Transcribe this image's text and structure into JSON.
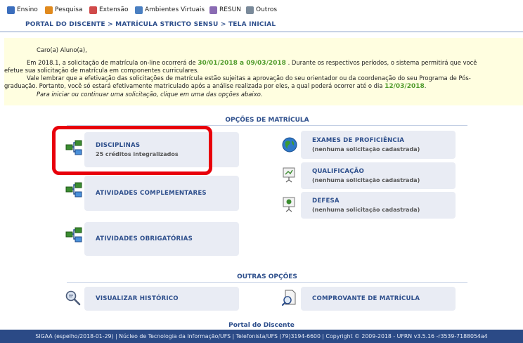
{
  "menu": {
    "items": [
      {
        "label": "Ensino",
        "icon": "ensino-icon",
        "color": "#3b6ebd"
      },
      {
        "label": "Pesquisa",
        "icon": "pesquisa-icon",
        "color": "#e08a1e"
      },
      {
        "label": "Extensão",
        "icon": "extensao-icon",
        "color": "#d04a4a"
      },
      {
        "label": "Ambientes Virtuais",
        "icon": "ambientes-virtuais-icon",
        "color": "#4a7fc1"
      },
      {
        "label": "RESUN",
        "icon": "resun-icon",
        "color": "#8a6bb3"
      },
      {
        "label": "Outros",
        "icon": "outros-icon",
        "color": "#7a8a9a"
      }
    ]
  },
  "breadcrumb": "PORTAL DO DISCENTE > MATRÍCULA STRICTO SENSU > TELA INICIAL",
  "notice": {
    "greeting": "Caro(a) Aluno(a),",
    "line1_pre": "Em 2018.1, a solicitação de matrícula on-line ocorrerá de ",
    "line1_date": "30/01/2018 a 09/03/2018",
    "line1_post": " . Durante os respectivos períodos, o sistema permitirá que você",
    "line2": "efetue sua solicitação de matrícula em componentes curriculares.",
    "line3": "Vale lembrar que a efetivação das solicitações de matrícula estão sujeitas a aprovação do seu orientador ou da coordenação do seu Programa de Pós-",
    "line4_pre": "graduação. Portanto, você só estará efetivamente matriculado após a análise realizada por eles, a qual poderá ocorrer até o dia ",
    "line4_date": "12/03/2018",
    "line4_post": ".",
    "line5": "Para iniciar ou continuar uma solicitação, clique em uma das opções abaixo."
  },
  "opcoes_title": "OPÇÕES DE MATRÍCULA",
  "left_cards": [
    {
      "title": "DISCIPLINAS",
      "sub": "25 créditos integralizados"
    },
    {
      "title": "ATIVIDADES COMPLEMENTARES",
      "sub": ""
    },
    {
      "title": "ATIVIDADES OBRIGATÓRIAS",
      "sub": ""
    }
  ],
  "right_cards": [
    {
      "title": "EXAMES DE PROFICIÊNCIA",
      "sub": "(nenhuma solicitação cadastrada)"
    },
    {
      "title": "QUALIFICAÇÃO",
      "sub": "(nenhuma solicitação cadastrada)"
    },
    {
      "title": "DEFESA",
      "sub": "(nenhuma solicitação cadastrada)"
    }
  ],
  "outras_title": "OUTRAS OPÇÕES",
  "outras": [
    {
      "title": "VISUALIZAR HISTÓRICO"
    },
    {
      "title": "COMPROVANTE DE MATRÍCULA"
    }
  ],
  "footer_label": "Portal do Discente",
  "footer": "SIGAA (espelho/2018-01-29) | Núcleo de Tecnologia da Informação/UFS | Telefonista/UFS (79)3194-6600 | Copyright © 2009-2018 - UFRN v3.5.16 -r3539-7188054a4",
  "colors": {
    "accent": "#2e4f8c",
    "date": "#4f9a2b",
    "highlight": "#e8000b",
    "footer_bg": "#2b4a86"
  }
}
